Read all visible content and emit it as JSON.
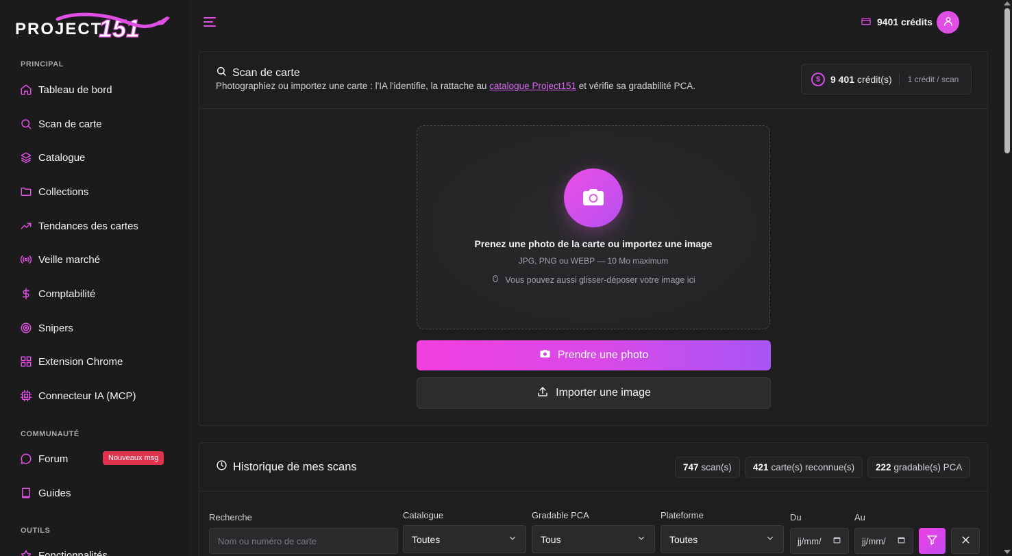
{
  "app": {
    "logo_text": "PROJECT 151",
    "accent": "#e04fe3",
    "accent_alt": "#a855f7"
  },
  "sidebar": {
    "section_principal": "PRINCIPAL",
    "section_communaute": "COMMUNAUTÉ",
    "section_outils": "OUTILS",
    "items": [
      {
        "label": "Tableau de bord",
        "icon": "home-icon"
      },
      {
        "label": "Scan de carte",
        "icon": "search-icon"
      },
      {
        "label": "Catalogue",
        "icon": "layers-icon"
      },
      {
        "label": "Collections",
        "icon": "folder-icon"
      },
      {
        "label": "Tendances des cartes",
        "icon": "trending-up-icon"
      },
      {
        "label": "Veille marché",
        "icon": "broadcast-icon"
      },
      {
        "label": "Comptabilité",
        "icon": "dollar-icon"
      },
      {
        "label": "Snipers",
        "icon": "target-icon"
      },
      {
        "label": "Extension Chrome",
        "icon": "grid-icon"
      },
      {
        "label": "Connecteur IA (MCP)",
        "icon": "cpu-icon"
      }
    ],
    "community": [
      {
        "label": "Forum",
        "icon": "message-circle-icon",
        "badge": "Nouveaux msg"
      },
      {
        "label": "Guides",
        "icon": "book-icon"
      }
    ],
    "tools": [
      {
        "label": "Fonctionnalités",
        "icon": "star-icon"
      }
    ]
  },
  "topbar": {
    "credits": "9401 crédits"
  },
  "scan": {
    "title": "Scan de carte",
    "desc_before": "Photographiez ou importez une carte : l'IA l'identifie, la rattache au ",
    "desc_link": "catalogue Project151",
    "desc_after": " et vérifie sa gradabilité PCA.",
    "credit_amount": "9 401",
    "credit_unit": "crédit(s)",
    "credit_rate": "1 crédit / scan",
    "dropzone_title": "Prenez une photo de la carte ou importez une image",
    "dropzone_formats": "JPG, PNG ou WEBP — 10 Mo maximum",
    "dropzone_hint": "Vous pouvez aussi glisser-déposer votre image ici",
    "btn_photo": "Prendre une photo",
    "btn_import": "Importer une image"
  },
  "history": {
    "title": "Historique de mes scans",
    "stats": [
      {
        "value": "747",
        "label": "scan(s)"
      },
      {
        "value": "421",
        "label": "carte(s) reconnue(s)"
      },
      {
        "value": "222",
        "label": "gradable(s) PCA"
      }
    ],
    "filters": {
      "search_label": "Recherche",
      "search_placeholder": "Nom ou numéro de carte",
      "catalogue_label": "Catalogue",
      "catalogue_value": "Toutes",
      "gradable_label": "Gradable PCA",
      "gradable_value": "Tous",
      "platform_label": "Plateforme",
      "platform_value": "Toutes",
      "from_label": "Du",
      "from_value": "jj/mm/",
      "to_label": "Au",
      "to_value": "jj/mm/"
    }
  }
}
